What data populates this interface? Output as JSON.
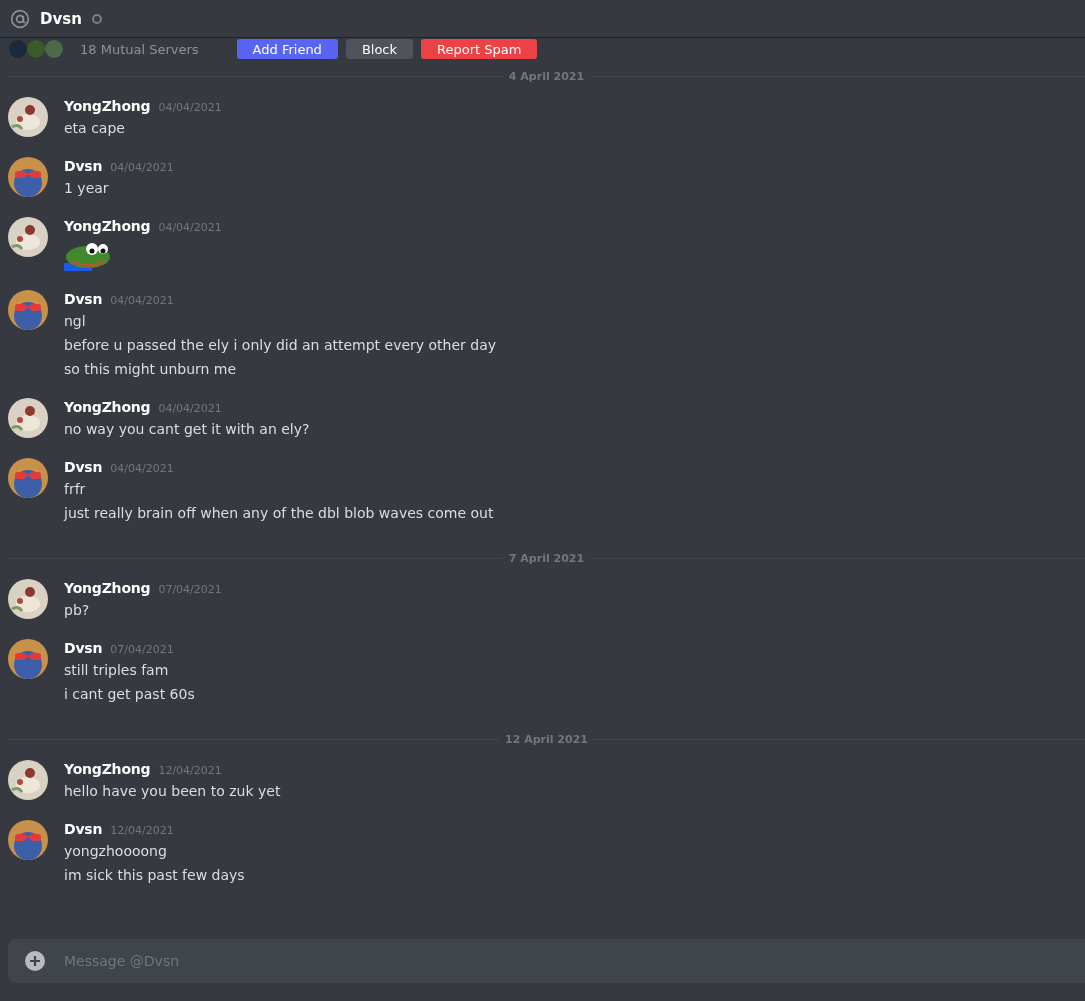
{
  "header": {
    "title": "Dvsn",
    "online": false
  },
  "profile_strip": {
    "mutual_servers": "18 Mutual Servers",
    "buttons": [
      {
        "label": "Add Friend",
        "kind": "primary"
      },
      {
        "label": "Block",
        "kind": "secondary"
      },
      {
        "label": "Report Spam",
        "kind": "danger"
      }
    ]
  },
  "feed": [
    {
      "kind": "divider",
      "label": "4 April 2021"
    },
    {
      "kind": "message",
      "author": "YongZhong",
      "avatar": {
        "kind": "pet"
      },
      "timestamp": "04/04/2021",
      "lines": [
        {
          "kind": "text",
          "text": "eta cape"
        }
      ]
    },
    {
      "kind": "message",
      "author": "Dvsn",
      "avatar": {
        "kind": "cartoon"
      },
      "timestamp": "04/04/2021",
      "lines": [
        {
          "kind": "text",
          "text": "1 year"
        }
      ]
    },
    {
      "kind": "message",
      "author": "YongZhong",
      "avatar": {
        "kind": "pet"
      },
      "timestamp": "04/04/2021",
      "lines": [
        {
          "kind": "emoji"
        }
      ]
    },
    {
      "kind": "message",
      "author": "Dvsn",
      "avatar": {
        "kind": "cartoon"
      },
      "timestamp": "04/04/2021",
      "lines": [
        {
          "kind": "text",
          "text": "ngl"
        },
        {
          "kind": "text",
          "text": "before u passed the ely i only did an attempt every other day"
        },
        {
          "kind": "text",
          "text": "so this might unburn me"
        }
      ]
    },
    {
      "kind": "message",
      "author": "YongZhong",
      "avatar": {
        "kind": "pet"
      },
      "timestamp": "04/04/2021",
      "lines": [
        {
          "kind": "text",
          "text": "no way you cant get it with an ely?"
        }
      ]
    },
    {
      "kind": "message",
      "author": "Dvsn",
      "avatar": {
        "kind": "cartoon"
      },
      "timestamp": "04/04/2021",
      "lines": [
        {
          "kind": "text",
          "text": "frfr"
        },
        {
          "kind": "text",
          "text": "just really brain off when any of the dbl blob waves come out"
        }
      ]
    },
    {
      "kind": "divider",
      "label": "7 April 2021"
    },
    {
      "kind": "message",
      "author": "YongZhong",
      "avatar": {
        "kind": "pet"
      },
      "timestamp": "07/04/2021",
      "lines": [
        {
          "kind": "text",
          "text": "pb?"
        }
      ]
    },
    {
      "kind": "message",
      "author": "Dvsn",
      "avatar": {
        "kind": "cartoon"
      },
      "timestamp": "07/04/2021",
      "lines": [
        {
          "kind": "text",
          "text": "still triples fam"
        },
        {
          "kind": "text",
          "text": "i cant get past 60s"
        }
      ]
    },
    {
      "kind": "divider",
      "label": "12 April 2021"
    },
    {
      "kind": "message",
      "author": "YongZhong",
      "avatar": {
        "kind": "pet"
      },
      "timestamp": "12/04/2021",
      "lines": [
        {
          "kind": "text",
          "text": "hello have you been to zuk yet"
        }
      ]
    },
    {
      "kind": "message",
      "author": "Dvsn",
      "avatar": {
        "kind": "cartoon"
      },
      "timestamp": "12/04/2021",
      "lines": [
        {
          "kind": "text",
          "text": "yongzhoooong"
        },
        {
          "kind": "text",
          "text": "im sick this past few days"
        }
      ]
    }
  ],
  "composer": {
    "placeholder": "Message @Dvsn"
  }
}
